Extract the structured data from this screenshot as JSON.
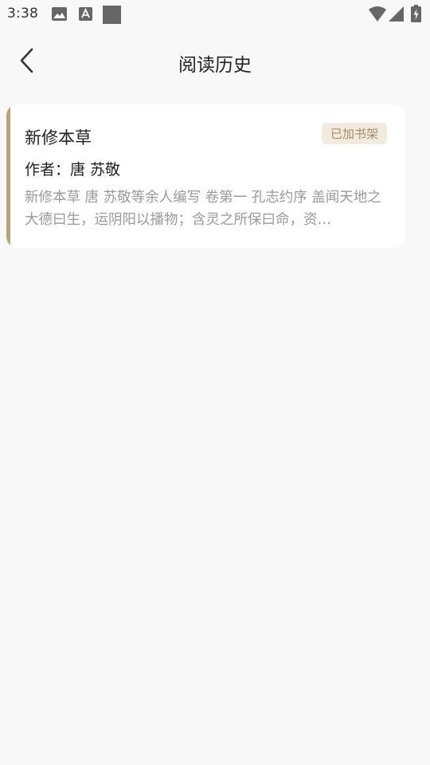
{
  "status_bar": {
    "time": "3:38",
    "icons": [
      "gallery-icon",
      "font-icon",
      "app-square-icon",
      "wifi-icon",
      "signal-icon",
      "battery-charging-icon"
    ]
  },
  "header": {
    "back_icon": "chevron-left-icon",
    "title": "阅读历史"
  },
  "history": [
    {
      "title": "新修本草",
      "author_line": "作者：唐 苏敬",
      "shelf_badge": "已加书架",
      "excerpt": "新修本草 唐 苏敬等余人编写 卷第一 孔志约序 盖闻天地之大德曰生，运阴阳以播物；含灵之所保曰命，资…"
    }
  ],
  "colors": {
    "background": "#f8f8f8",
    "card": "#ffffff",
    "accent": "#b9a17e",
    "badge_bg": "#f1ebdf",
    "badge_text": "#a58c68",
    "excerpt_text": "#9a9a9a"
  }
}
